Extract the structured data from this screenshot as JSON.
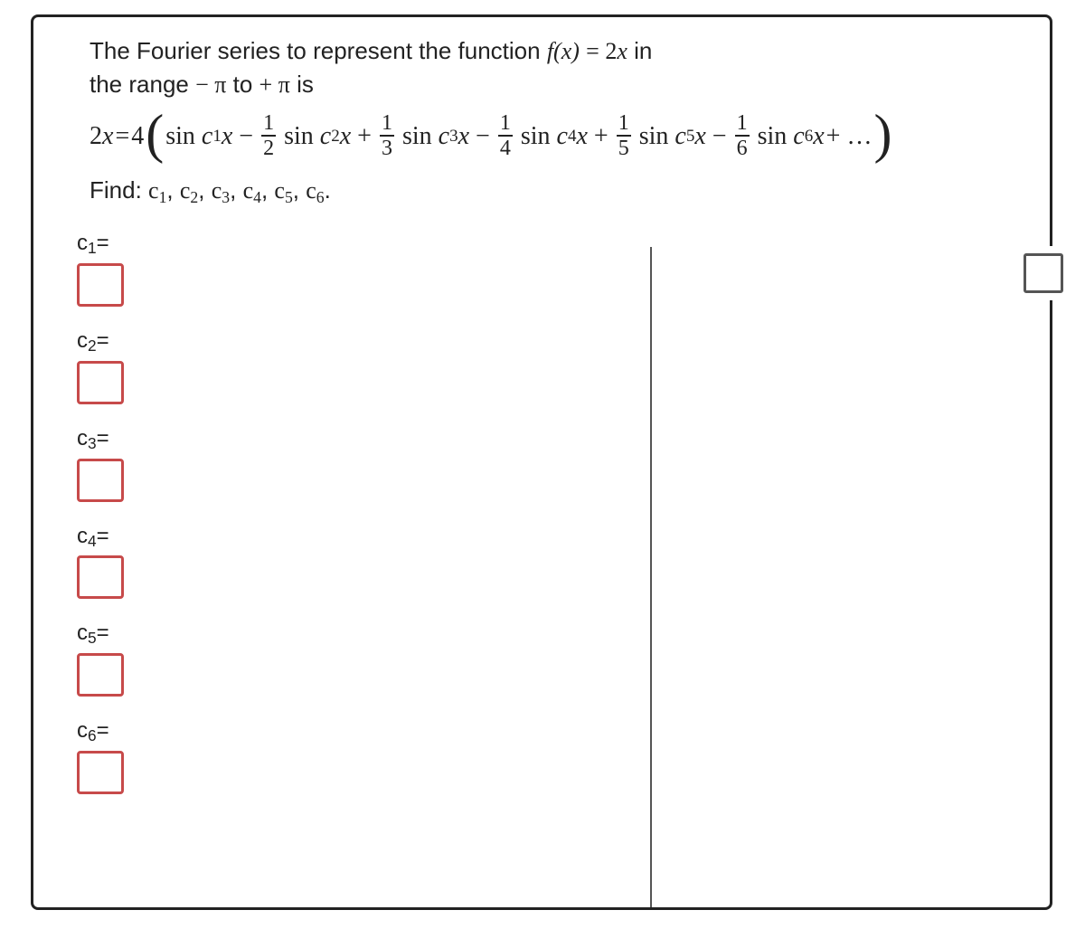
{
  "prompt": {
    "line1_prefix": "The Fourier series to represent the function ",
    "f_of_x": "f(x)",
    "eq_sign": " = ",
    "two_x": "2x",
    "in_word": " in",
    "line2_prefix": "the range ",
    "minus_pi": "− π",
    "to_word": " to ",
    "plus_pi": "+ π",
    "is_word": " is"
  },
  "equation": {
    "lhs": "2x",
    "eq": " = ",
    "coeff": "4",
    "terms": [
      {
        "sign": "",
        "num": "",
        "den": "",
        "fn": "sin",
        "c_label": "c",
        "c_sub": "1",
        "x": "x"
      },
      {
        "sign": "−",
        "num": "1",
        "den": "2",
        "fn": "sin",
        "c_label": "c",
        "c_sub": "2",
        "x": "x"
      },
      {
        "sign": "+",
        "num": "1",
        "den": "3",
        "fn": "sin",
        "c_label": "c",
        "c_sub": "3",
        "x": "x"
      },
      {
        "sign": "−",
        "num": "1",
        "den": "4",
        "fn": "sin",
        "c_label": "c",
        "c_sub": "4",
        "x": "x"
      },
      {
        "sign": "+",
        "num": "1",
        "den": "5",
        "fn": "sin",
        "c_label": "c",
        "c_sub": "5",
        "x": "x"
      },
      {
        "sign": "−",
        "num": "1",
        "den": "6",
        "fn": "sin",
        "c_label": "c",
        "c_sub": "6",
        "x": "x"
      }
    ],
    "trailing": " + …"
  },
  "find": {
    "prefix": "Find: ",
    "items": [
      "c₁",
      "c₂",
      "c₃",
      "c₄",
      "c₅",
      "c₆"
    ],
    "sep": ", ",
    "tail": "."
  },
  "inputs": [
    {
      "label_c": "c",
      "label_sub": "1",
      "label_eq": "=",
      "value": ""
    },
    {
      "label_c": "c",
      "label_sub": "2",
      "label_eq": "=",
      "value": ""
    },
    {
      "label_c": "c",
      "label_sub": "3",
      "label_eq": "=",
      "value": ""
    },
    {
      "label_c": "c",
      "label_sub": "4",
      "label_eq": "=",
      "value": ""
    },
    {
      "label_c": "c",
      "label_sub": "5",
      "label_eq": "=",
      "value": ""
    },
    {
      "label_c": "c",
      "label_sub": "6",
      "label_eq": "=",
      "value": ""
    }
  ],
  "flag": {
    "title": "flag-question"
  }
}
